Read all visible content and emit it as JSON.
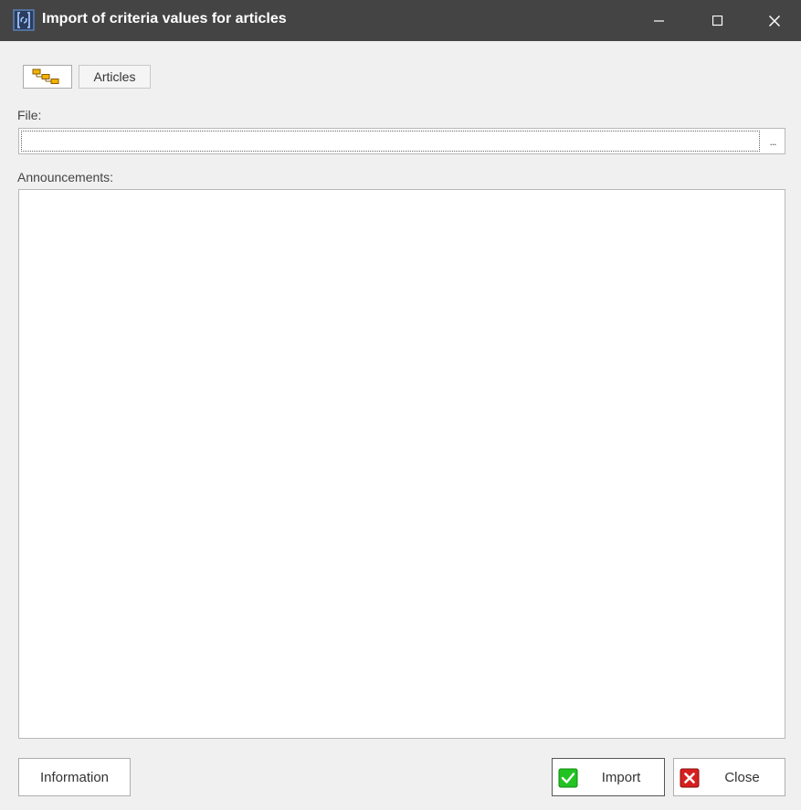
{
  "window": {
    "title": "Import of criteria values for articles",
    "icon": "app-link-icon",
    "controls": [
      "minimize-icon",
      "maximize-icon",
      "close-icon"
    ]
  },
  "toolbar": {
    "tree_icon": "hierarchy-icon",
    "articles_label": "Articles"
  },
  "file": {
    "label": "File:",
    "value": "",
    "browse_label": "..."
  },
  "announcements": {
    "label": "Announcements:",
    "content": ""
  },
  "buttons": {
    "information": "Information",
    "import": "Import",
    "close": "Close"
  },
  "colors": {
    "titlebar": "#444444",
    "import_icon": "#22c322",
    "close_icon": "#d62020"
  }
}
